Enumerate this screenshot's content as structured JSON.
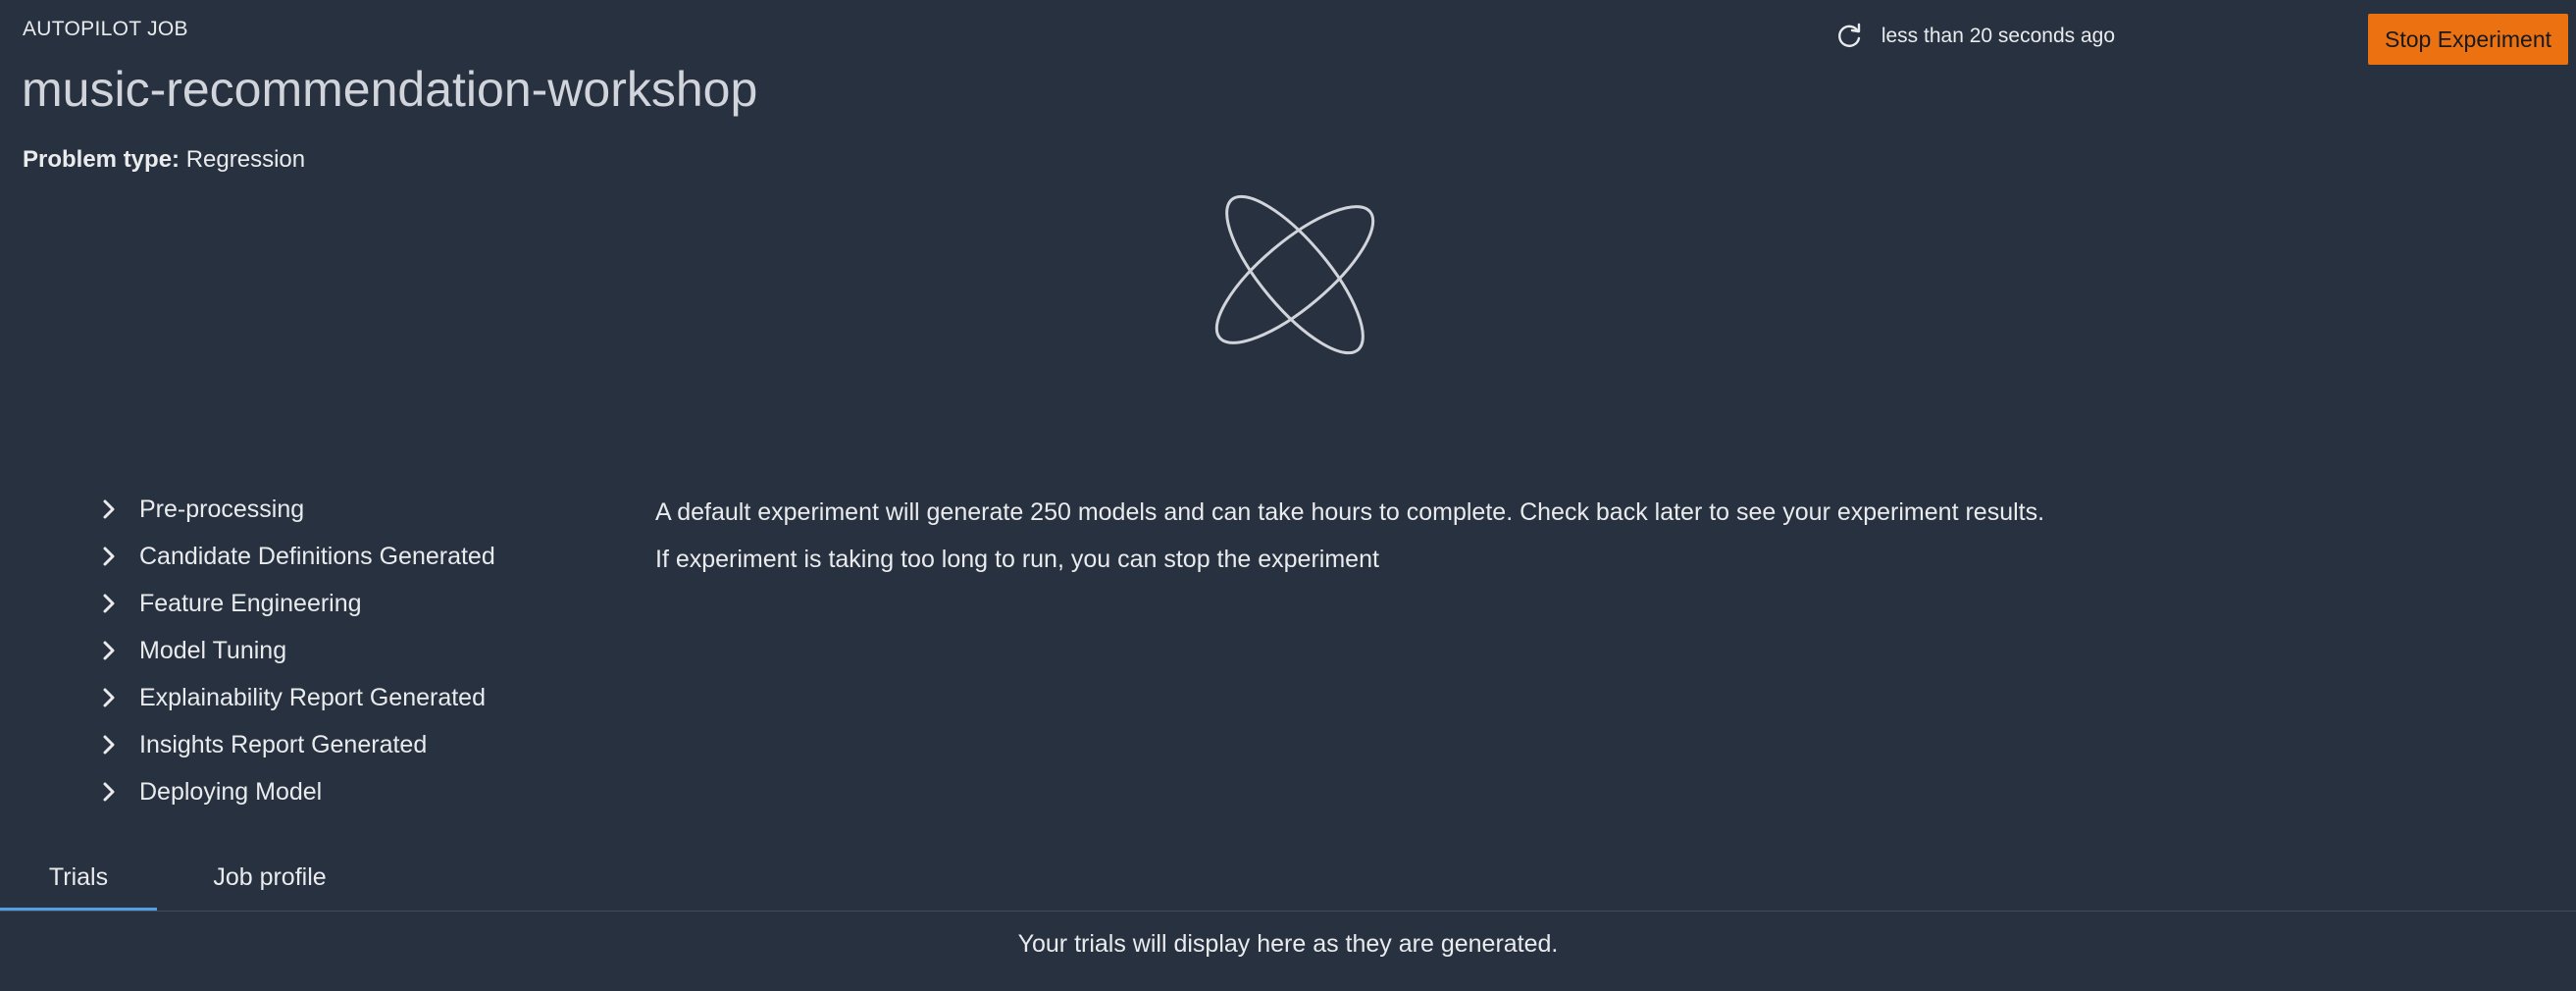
{
  "header": {
    "eyebrow": "AUTOPILOT JOB",
    "title": "music-recommendation-workshop",
    "problem_type_label": "Problem type:",
    "problem_type_value": "Regression",
    "refresh_text": "less than 20 seconds ago",
    "stop_button": "Stop Experiment"
  },
  "steps": [
    {
      "label": "Pre-processing"
    },
    {
      "label": "Candidate Definitions Generated"
    },
    {
      "label": "Feature Engineering"
    },
    {
      "label": "Model Tuning"
    },
    {
      "label": "Explainability Report Generated"
    },
    {
      "label": "Insights Report Generated"
    },
    {
      "label": "Deploying Model"
    }
  ],
  "info": {
    "line1": "A default experiment will generate 250 models and can take hours to complete. Check back later to see your experiment results.",
    "line2": "If experiment is taking too long to run, you can stop the experiment"
  },
  "tabs": [
    {
      "label": "Trials",
      "active": true
    },
    {
      "label": "Job profile",
      "active": false
    }
  ],
  "trials_empty": "Your trials will display here as they are generated.",
  "colors": {
    "background": "#283140",
    "accent_button": "#ec7211",
    "active_tab": "#539fe5"
  },
  "icons": {
    "refresh": "refresh-icon",
    "spinner": "orbit-spinner-icon",
    "expand": "chevron-right-icon"
  }
}
